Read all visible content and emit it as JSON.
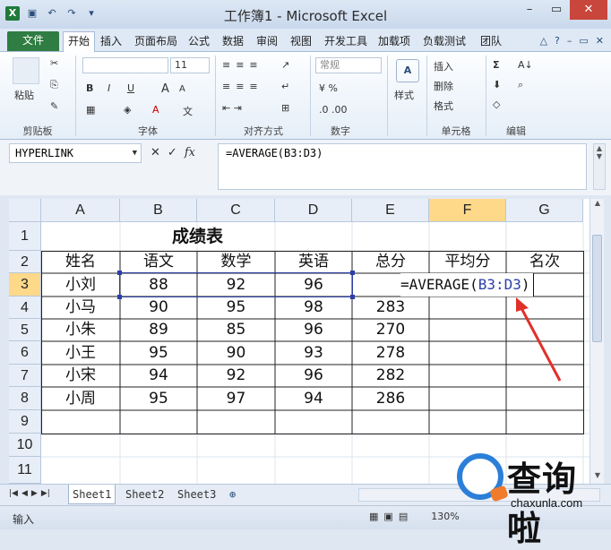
{
  "app": {
    "title": "工作簿1 - Microsoft Excel",
    "win_buttons": [
      "–",
      "▭",
      "✕"
    ]
  },
  "ribbon_tabs": [
    "文件",
    "开始",
    "插入",
    "页面布局",
    "公式",
    "数据",
    "审阅",
    "视图",
    "开发工具",
    "加载项",
    "负载测试",
    "团队"
  ],
  "ribbon": {
    "clipboard": {
      "label": "剪贴板",
      "paste": "粘贴"
    },
    "font": {
      "label": "字体",
      "size": "11",
      "bold": "B",
      "italic": "I",
      "underline": "U",
      "grow": "A",
      "shrink": "A"
    },
    "alignment": {
      "label": "对齐方式"
    },
    "number": {
      "label": "数字",
      "format": "常规"
    },
    "styles": {
      "label": "样式"
    },
    "cells": {
      "label": "单元格",
      "insert": "插入",
      "delete": "删除",
      "format": "格式"
    },
    "editing": {
      "label": "编辑",
      "sum": "Σ"
    }
  },
  "formula_bar": {
    "name_box": "HYPERLINK",
    "fx": "fx",
    "formula": "=AVERAGE(B3:D3)"
  },
  "sheet": {
    "columns": [
      "A",
      "B",
      "C",
      "D",
      "E",
      "F",
      "G"
    ],
    "rows": [
      "1",
      "2",
      "3",
      "4",
      "5",
      "6",
      "7",
      "8",
      "9",
      "10",
      "11"
    ],
    "title": "成绩表",
    "headers": [
      "姓名",
      "语文",
      "数学",
      "英语",
      "总分",
      "平均分",
      "名次"
    ],
    "data": [
      [
        "小刘",
        "88",
        "92",
        "96",
        "",
        "",
        ""
      ],
      [
        "小马",
        "90",
        "95",
        "98",
        "283",
        "",
        ""
      ],
      [
        "小朱",
        "89",
        "85",
        "96",
        "270",
        "",
        ""
      ],
      [
        "小王",
        "95",
        "90",
        "93",
        "278",
        "",
        ""
      ],
      [
        "小宋",
        "94",
        "92",
        "96",
        "282",
        "",
        ""
      ],
      [
        "小周",
        "95",
        "97",
        "94",
        "286",
        "",
        ""
      ]
    ],
    "editing_formula_prefix": "=AVERAGE(",
    "editing_formula_ref": "B3:D3",
    "editing_formula_suffix": ")"
  },
  "sheet_tabs": [
    "Sheet1",
    "Sheet2",
    "Sheet3"
  ],
  "status": {
    "mode": "输入",
    "zoom": "130%"
  },
  "watermark": {
    "text": "查询啦",
    "url": "chaxunla.com"
  }
}
